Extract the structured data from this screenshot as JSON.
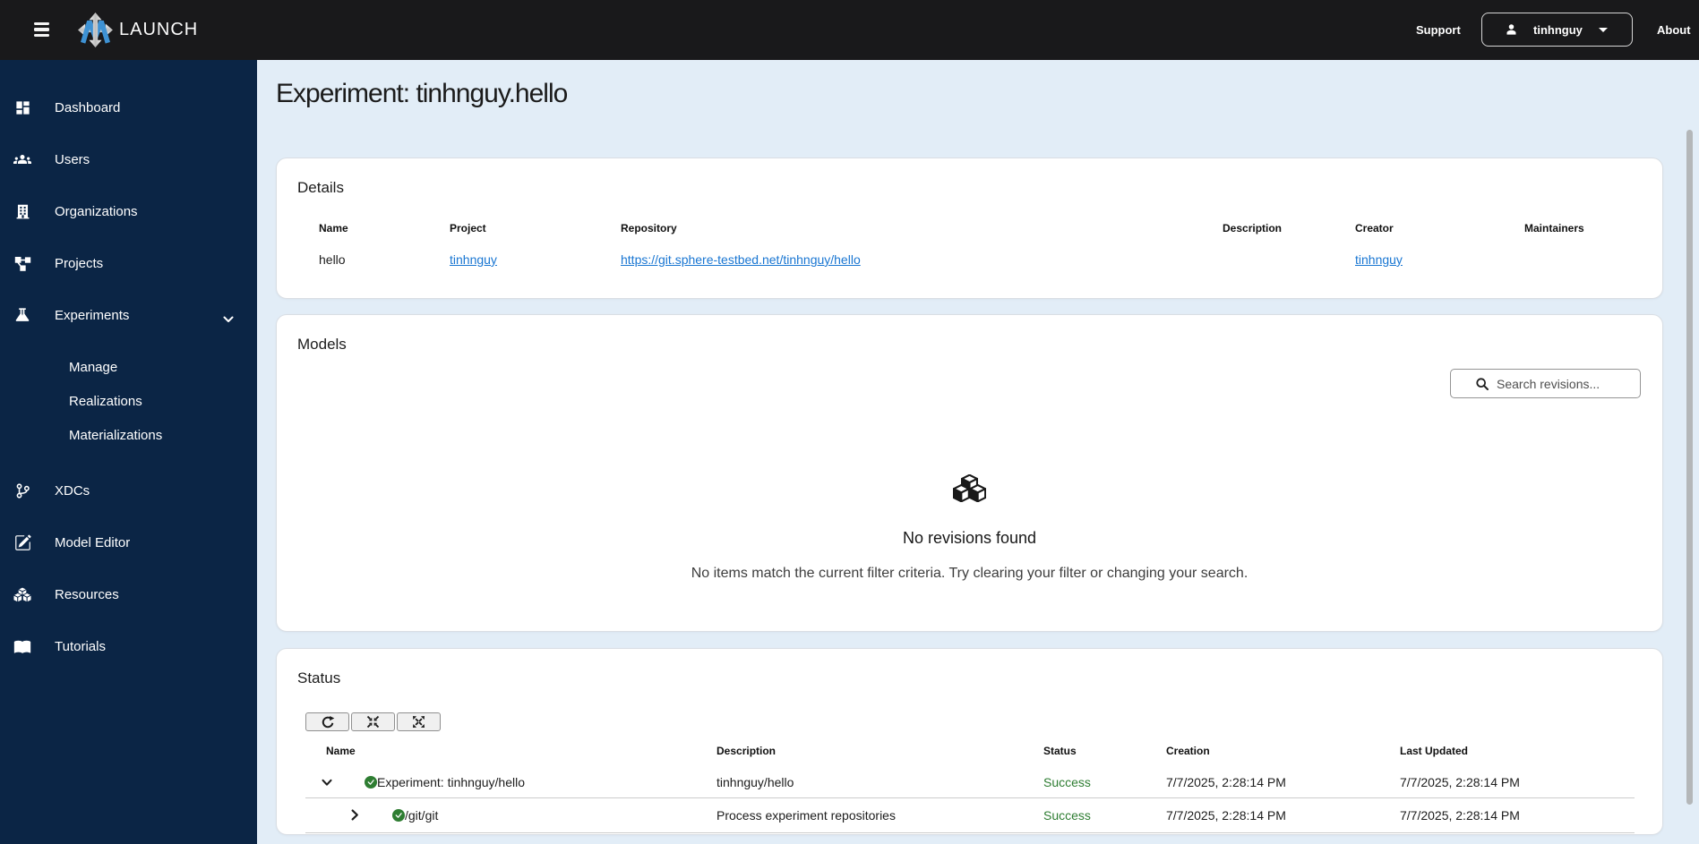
{
  "topbar": {
    "brand": "LAUNCH",
    "support": "Support",
    "username": "tinhnguy",
    "about": "About"
  },
  "sidebar": {
    "items": [
      {
        "label": "Dashboard",
        "icon": "dashboard-icon"
      },
      {
        "label": "Users",
        "icon": "users-icon"
      },
      {
        "label": "Organizations",
        "icon": "organization-icon"
      },
      {
        "label": "Projects",
        "icon": "projects-icon"
      },
      {
        "label": "Experiments",
        "icon": "experiments-flask-icon",
        "expanded": true
      },
      {
        "label": "XDCs",
        "icon": "git-branch-icon"
      },
      {
        "label": "Model Editor",
        "icon": "edit-square-icon"
      },
      {
        "label": "Resources",
        "icon": "cubes-icon"
      },
      {
        "label": "Tutorials",
        "icon": "book-icon"
      }
    ],
    "experiments_submenu": [
      {
        "label": "Manage"
      },
      {
        "label": "Realizations"
      },
      {
        "label": "Materializations"
      }
    ]
  },
  "page": {
    "title": "Experiment: tinhnguy.hello"
  },
  "details": {
    "title": "Details",
    "headers": [
      "Name",
      "Project",
      "Repository",
      "Description",
      "Creator",
      "Maintainers"
    ],
    "row": {
      "name": "hello",
      "project": "tinhnguy",
      "repository": "https://git.sphere-testbed.net/tinhnguy/hello",
      "description": "",
      "creator": "tinhnguy",
      "maintainers": ""
    }
  },
  "models": {
    "title": "Models",
    "search_placeholder": "Search revisions...",
    "empty_icon": "boxes-icon",
    "empty_title": "No revisions found",
    "empty_message": "No items match the current filter criteria. Try clearing your filter or changing your search."
  },
  "status": {
    "title": "Status",
    "toolbar_icons": [
      "refresh-icon",
      "collapse-icon",
      "expand-icon"
    ],
    "headers": [
      "Name",
      "Description",
      "Status",
      "Creation",
      "Last Updated"
    ],
    "rows": [
      {
        "name": "Experiment: tinhnguy/hello",
        "description": "tinhnguy/hello",
        "status": "Success",
        "creation": "7/7/2025, 2:28:14 PM",
        "last_updated": "7/7/2025, 2:28:14 PM",
        "level": 0,
        "expanded": true
      },
      {
        "name": "/git/git",
        "description": "Process experiment repositories",
        "status": "Success",
        "creation": "7/7/2025, 2:28:14 PM",
        "last_updated": "7/7/2025, 2:28:14 PM",
        "level": 1,
        "expanded": false
      }
    ]
  },
  "colors": {
    "topbar_bg": "#19191b",
    "sidebar_bg": "#0b2545",
    "content_bg": "#e2edf7",
    "link_blue": "#1976d2",
    "success_green": "#2e7d32",
    "logo_blue": "#3e92d4"
  }
}
